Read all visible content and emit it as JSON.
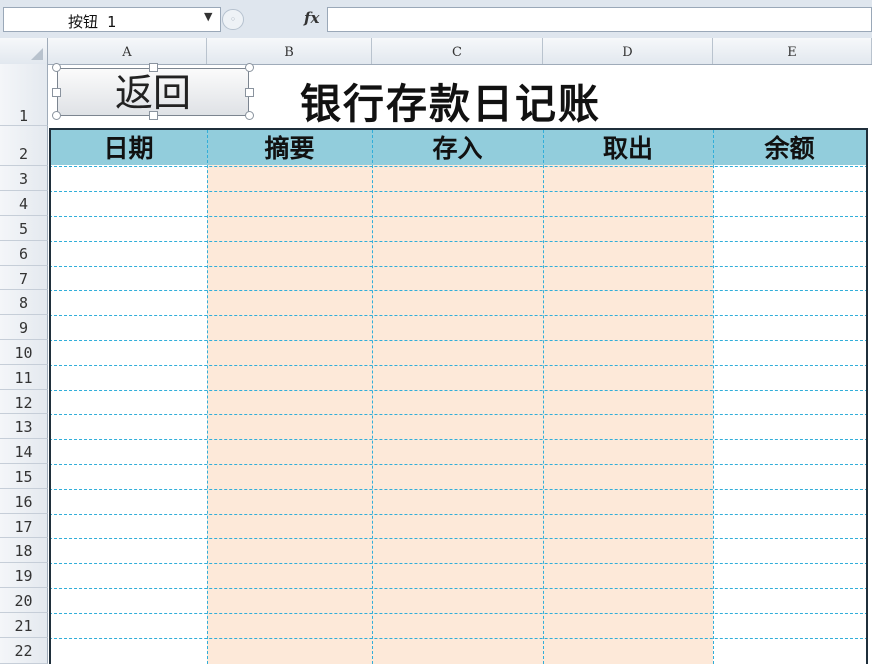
{
  "formula_bar": {
    "name_box": "按钮 1",
    "fx_label": "fx",
    "formula": ""
  },
  "columns": [
    "A",
    "B",
    "C",
    "D",
    "E"
  ],
  "rows": [
    "1",
    "2",
    "3",
    "4",
    "5",
    "6",
    "7",
    "8",
    "9",
    "10",
    "11",
    "12",
    "13",
    "14",
    "15",
    "16",
    "17",
    "18",
    "19",
    "20",
    "21",
    "22"
  ],
  "back_button": {
    "label": "返回"
  },
  "sheet_title": "银行存款日记账",
  "table": {
    "headers": [
      "日期",
      "摘要",
      "存入",
      "取出",
      "余额"
    ]
  },
  "colors": {
    "header_fill": "#92cddc",
    "shaded_fill": "#fde9d9",
    "grid_line": "#31aed9"
  }
}
